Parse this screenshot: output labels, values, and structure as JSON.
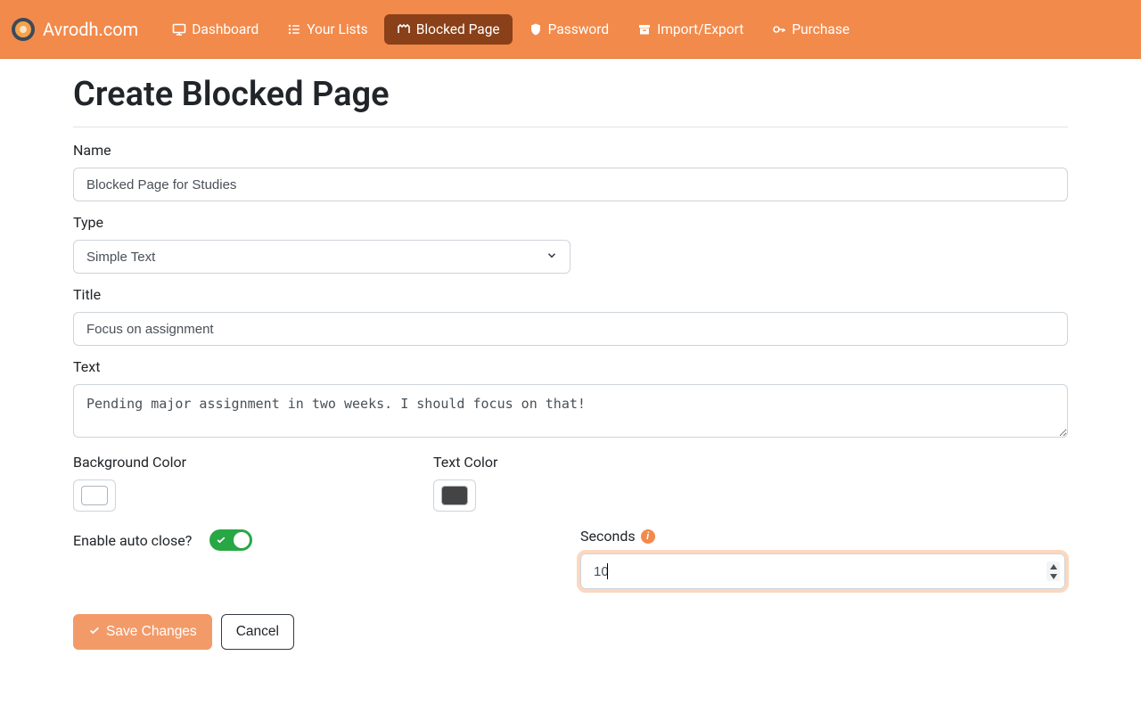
{
  "brand": {
    "name": "Avrodh.com"
  },
  "nav": {
    "items": [
      {
        "label": "Dashboard",
        "icon": "monitor"
      },
      {
        "label": "Your Lists",
        "icon": "list"
      },
      {
        "label": "Blocked Page",
        "icon": "barrier",
        "active": true
      },
      {
        "label": "Password",
        "icon": "shield"
      },
      {
        "label": "Import/Export",
        "icon": "archive"
      },
      {
        "label": "Purchase",
        "icon": "key"
      }
    ]
  },
  "page": {
    "title": "Create Blocked Page"
  },
  "form": {
    "name": {
      "label": "Name",
      "value": "Blocked Page for Studies"
    },
    "type": {
      "label": "Type",
      "selected": "Simple Text"
    },
    "title_field": {
      "label": "Title",
      "value": "Focus on assignment"
    },
    "text": {
      "label": "Text",
      "value": "Pending major assignment in two weeks. I should focus on that!"
    },
    "background_color": {
      "label": "Background Color",
      "value": "#ffffff"
    },
    "text_color": {
      "label": "Text Color",
      "value": "#444444"
    },
    "enable_auto_close": {
      "label": "Enable auto close?",
      "value": true
    },
    "seconds": {
      "label": "Seconds",
      "value": "10"
    },
    "buttons": {
      "save": "Save Changes",
      "cancel": "Cancel"
    }
  }
}
